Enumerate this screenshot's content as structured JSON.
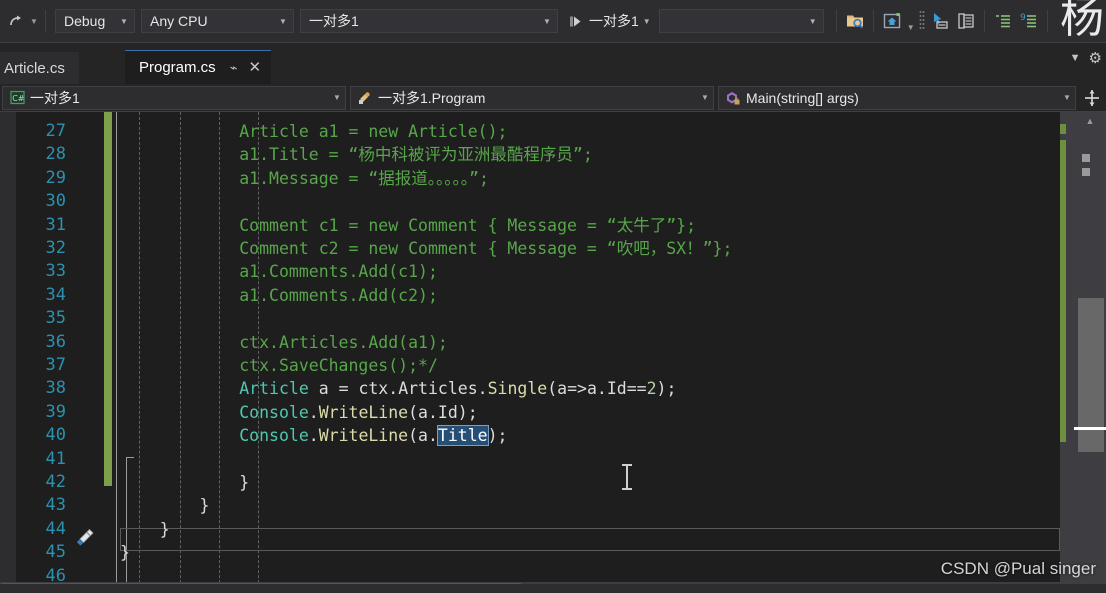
{
  "toolbar": {
    "undo_icon": "redo-arrow-icon",
    "config_value": "Debug",
    "platform_value": "Any CPU",
    "startup_value": "一对多1",
    "run_label": "一对多1",
    "search_value": "",
    "icons": [
      {
        "name": "folder-search-icon"
      },
      {
        "name": "home-window-icon"
      },
      {
        "name": "pointer-window-icon"
      },
      {
        "name": "properties-window-icon"
      },
      {
        "name": "indent-list-icon"
      },
      {
        "name": "comment-list-icon"
      }
    ],
    "watermark_char": "杨"
  },
  "tabs": {
    "items": [
      {
        "label": "Article.cs",
        "active": false
      },
      {
        "label": "Program.cs",
        "active": true
      }
    ],
    "pin_icon": "pin-icon",
    "close_icon": "close-icon"
  },
  "navbar": {
    "project": "一对多1",
    "project_icon": "csharp-project-icon",
    "type": "一对多1.Program",
    "type_icon": "class-icon",
    "member": "Main(string[] args)",
    "member_icon": "method-private-icon",
    "split_icon": "split-view-icon"
  },
  "editor": {
    "first_line": 27,
    "selection_text": "Title",
    "quick_action_icon": "quick-actions-brush-icon",
    "colors": {
      "background": "#1e1e1e",
      "comment": "#57a64a",
      "type": "#4ec9b0",
      "method": "#dcdcaa",
      "identifier": "#dcdcdc",
      "number": "#b5cea8",
      "line_number": "#2b91af",
      "selection": "#264f78",
      "change_bar": "#7ea04d"
    },
    "lines": [
      {
        "n": 27,
        "indent": 3,
        "tokens": [
          {
            "t": "Article a1 = new Article();",
            "c": "cm"
          }
        ]
      },
      {
        "n": 28,
        "indent": 3,
        "tokens": [
          {
            "t": "a1.Title = “杨中科被评为亚洲最酷程序员”;",
            "c": "cm"
          }
        ]
      },
      {
        "n": 29,
        "indent": 3,
        "tokens": [
          {
            "t": "a1.Message = “据报道。。。。。”;",
            "c": "cm"
          }
        ]
      },
      {
        "n": 30,
        "indent": 0,
        "tokens": []
      },
      {
        "n": 31,
        "indent": 3,
        "tokens": [
          {
            "t": "Comment c1 = new Comment { Message = “太牛了”};",
            "c": "cm"
          }
        ]
      },
      {
        "n": 32,
        "indent": 3,
        "tokens": [
          {
            "t": "Comment c2 = new Comment { Message = “吹吧，SX！”};",
            "c": "cm"
          }
        ]
      },
      {
        "n": 33,
        "indent": 3,
        "tokens": [
          {
            "t": "a1.Comments.Add(c1);",
            "c": "cm"
          }
        ]
      },
      {
        "n": 34,
        "indent": 3,
        "tokens": [
          {
            "t": "a1.Comments.Add(c2);",
            "c": "cm"
          }
        ]
      },
      {
        "n": 35,
        "indent": 0,
        "tokens": []
      },
      {
        "n": 36,
        "indent": 3,
        "tokens": [
          {
            "t": "ctx.Articles.Add(a1);",
            "c": "cm"
          }
        ]
      },
      {
        "n": 37,
        "indent": 3,
        "tokens": [
          {
            "t": "ctx.SaveChanges();*/",
            "c": "cm"
          }
        ]
      },
      {
        "n": 38,
        "indent": 3,
        "tokens": [
          {
            "t": "Article",
            "c": "type"
          },
          {
            "t": " a = ",
            "c": "id"
          },
          {
            "t": "ctx",
            "c": "id"
          },
          {
            "t": ".",
            "c": "pun"
          },
          {
            "t": "Articles",
            "c": "id"
          },
          {
            "t": ".",
            "c": "pun"
          },
          {
            "t": "Single",
            "c": "mth"
          },
          {
            "t": "(a=>a.",
            "c": "id"
          },
          {
            "t": "Id",
            "c": "id"
          },
          {
            "t": "==",
            "c": "pun"
          },
          {
            "t": "2",
            "c": "num"
          },
          {
            "t": ");",
            "c": "pun"
          }
        ]
      },
      {
        "n": 39,
        "indent": 3,
        "tokens": [
          {
            "t": "Console",
            "c": "type"
          },
          {
            "t": ".",
            "c": "pun"
          },
          {
            "t": "WriteLine",
            "c": "mth"
          },
          {
            "t": "(a.",
            "c": "id"
          },
          {
            "t": "Id",
            "c": "id"
          },
          {
            "t": ");",
            "c": "pun"
          }
        ]
      },
      {
        "n": 40,
        "indent": 3,
        "current": true,
        "tokens": [
          {
            "t": "Console",
            "c": "type"
          },
          {
            "t": ".",
            "c": "pun"
          },
          {
            "t": "WriteLine",
            "c": "mth"
          },
          {
            "t": "(a.",
            "c": "id"
          },
          {
            "t": "Title",
            "c": "sel"
          },
          {
            "t": ");",
            "c": "pun"
          }
        ]
      },
      {
        "n": 41,
        "indent": 0,
        "tokens": []
      },
      {
        "n": 42,
        "indent": 0,
        "tokens": [
          {
            "t": "            }",
            "c": "pun"
          }
        ]
      },
      {
        "n": 43,
        "indent": 0,
        "tokens": [
          {
            "t": "        }",
            "c": "pun"
          }
        ]
      },
      {
        "n": 44,
        "indent": 0,
        "tokens": [
          {
            "t": "    }",
            "c": "pun"
          }
        ]
      },
      {
        "n": 45,
        "indent": 0,
        "tokens": [
          {
            "t": "}",
            "c": "pun"
          }
        ]
      },
      {
        "n": 46,
        "indent": 0,
        "tokens": []
      }
    ]
  },
  "watermark": {
    "text": "CSDN @Pual singer"
  }
}
